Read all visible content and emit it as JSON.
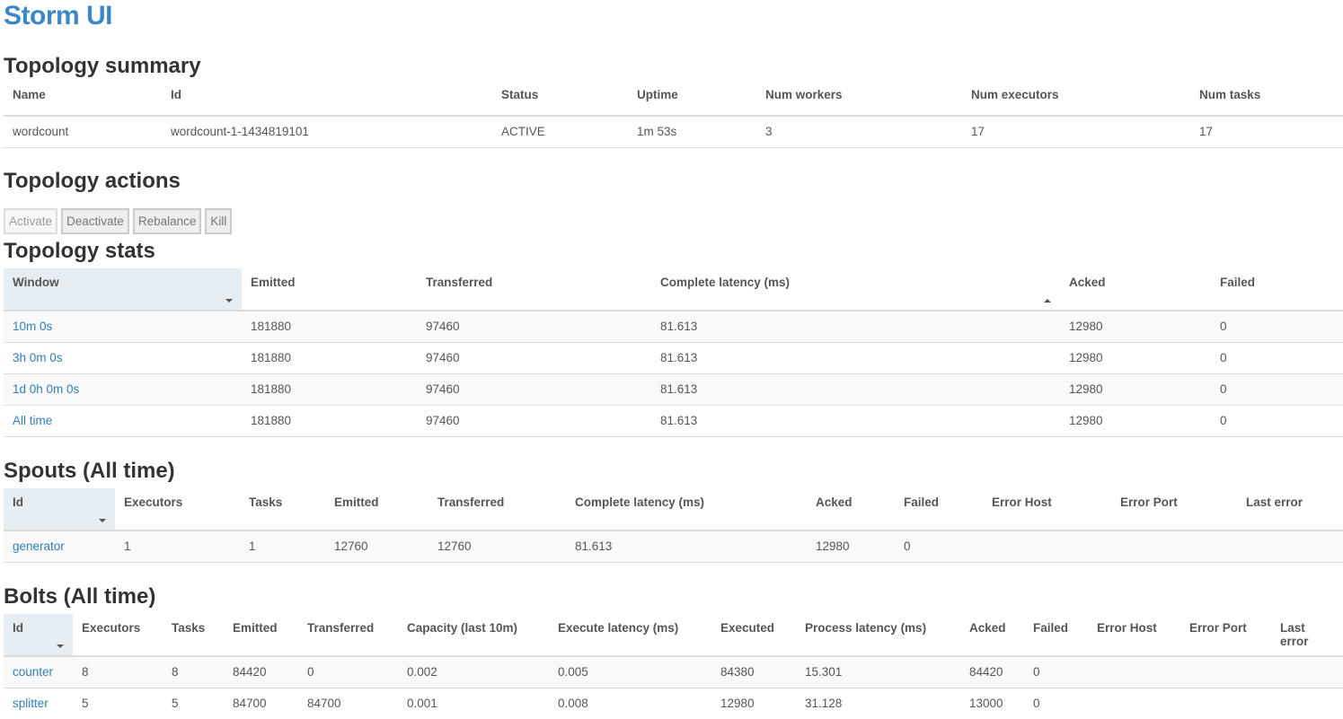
{
  "app": {
    "title": "Storm UI"
  },
  "summary": {
    "title": "Topology summary",
    "headers": [
      "Name",
      "Id",
      "Status",
      "Uptime",
      "Num workers",
      "Num executors",
      "Num tasks"
    ],
    "row": [
      "wordcount",
      "wordcount-1-1434819101",
      "ACTIVE",
      "1m 53s",
      "3",
      "17",
      "17"
    ]
  },
  "actions": {
    "title": "Topology actions",
    "buttons": [
      {
        "label": "Activate",
        "disabled": true
      },
      {
        "label": "Deactivate",
        "disabled": false
      },
      {
        "label": "Rebalance",
        "disabled": false
      },
      {
        "label": "Kill",
        "disabled": false
      }
    ]
  },
  "stats": {
    "title": "Topology stats",
    "headers": [
      "Window",
      "Emitted",
      "Transferred",
      "Complete latency (ms)",
      "Acked",
      "Failed"
    ],
    "rows": [
      [
        "10m 0s",
        "181880",
        "97460",
        "81.613",
        "12980",
        "0"
      ],
      [
        "3h 0m 0s",
        "181880",
        "97460",
        "81.613",
        "12980",
        "0"
      ],
      [
        "1d 0h 0m 0s",
        "181880",
        "97460",
        "81.613",
        "12980",
        "0"
      ],
      [
        "All time",
        "181880",
        "97460",
        "81.613",
        "12980",
        "0"
      ]
    ]
  },
  "spouts": {
    "title": "Spouts (All time)",
    "headers": [
      "Id",
      "Executors",
      "Tasks",
      "Emitted",
      "Transferred",
      "Complete latency (ms)",
      "Acked",
      "Failed",
      "Error Host",
      "Error Port",
      "Last error"
    ],
    "rows": [
      [
        "generator",
        "1",
        "1",
        "12760",
        "12760",
        "81.613",
        "12980",
        "0",
        "",
        "",
        ""
      ]
    ]
  },
  "bolts": {
    "title": "Bolts (All time)",
    "headers": [
      "Id",
      "Executors",
      "Tasks",
      "Emitted",
      "Transferred",
      "Capacity (last 10m)",
      "Execute latency (ms)",
      "Executed",
      "Process latency (ms)",
      "Acked",
      "Failed",
      "Error Host",
      "Error Port",
      "Last error"
    ],
    "rows": [
      [
        "counter",
        "8",
        "8",
        "84420",
        "0",
        "0.002",
        "0.005",
        "84380",
        "15.301",
        "84420",
        "0",
        "",
        "",
        ""
      ],
      [
        "splitter",
        "5",
        "5",
        "84700",
        "84700",
        "0.001",
        "0.008",
        "12980",
        "31.128",
        "13000",
        "0",
        "",
        "",
        ""
      ]
    ]
  },
  "colors": {
    "brand": "#3a87c9",
    "link": "#2f7ec2",
    "sort_header_bg": "#e6eef4"
  }
}
